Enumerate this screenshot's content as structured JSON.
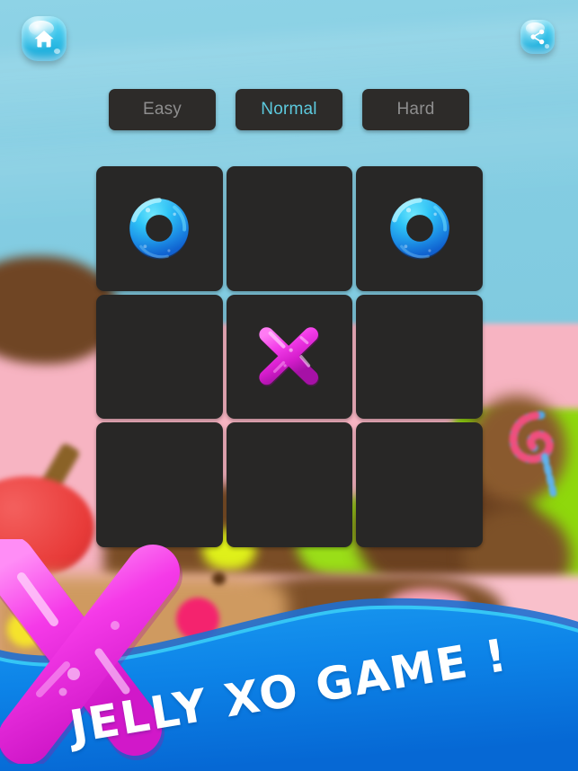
{
  "app": {
    "title": "Jelly XO Game",
    "banner_title": "JELLY XO GAME !"
  },
  "header": {
    "home_button": {
      "label": "Home",
      "icon": "home-icon"
    },
    "share_button": {
      "label": "Share",
      "icon": "share-icon"
    }
  },
  "difficulty": {
    "selected": "Normal",
    "options": [
      {
        "id": "easy",
        "label": "Easy",
        "selected": false
      },
      {
        "id": "normal",
        "label": "Normal",
        "selected": true
      },
      {
        "id": "hard",
        "label": "Hard",
        "selected": false
      }
    ]
  },
  "board": {
    "rows": 3,
    "cols": 3,
    "cells": [
      {
        "index": 0,
        "row": 0,
        "col": 0,
        "mark": "O"
      },
      {
        "index": 1,
        "row": 0,
        "col": 1,
        "mark": ""
      },
      {
        "index": 2,
        "row": 0,
        "col": 2,
        "mark": "O"
      },
      {
        "index": 3,
        "row": 1,
        "col": 0,
        "mark": ""
      },
      {
        "index": 4,
        "row": 1,
        "col": 1,
        "mark": "X"
      },
      {
        "index": 5,
        "row": 1,
        "col": 2,
        "mark": ""
      },
      {
        "index": 6,
        "row": 2,
        "col": 0,
        "mark": ""
      },
      {
        "index": 7,
        "row": 2,
        "col": 1,
        "mark": ""
      },
      {
        "index": 8,
        "row": 2,
        "col": 2,
        "mark": ""
      }
    ]
  },
  "colors": {
    "sky": "#84cde2",
    "cell": "#282726",
    "selected_text": "#5cc9dd",
    "unselected_text": "#8e8e8e",
    "o_piece": "#1f9df0",
    "x_piece": "#e62ee0",
    "banner_blue": "#0d84e8",
    "banner_edge_cyan": "#35c6f5",
    "jelly_button": "#41c7ec"
  }
}
